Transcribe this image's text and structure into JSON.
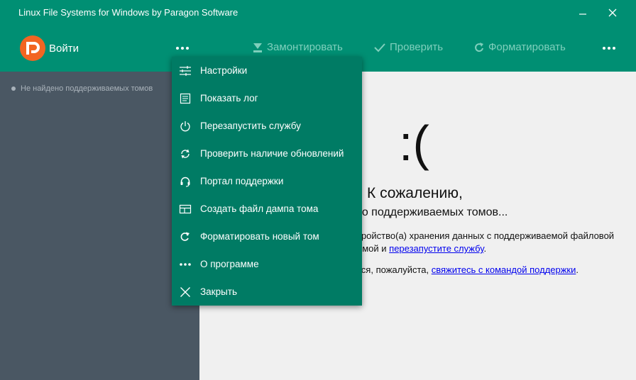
{
  "window": {
    "title": "Linux File Systems for Windows by Paragon Software"
  },
  "toolbar": {
    "login_label": "Войти",
    "mount_label": "Замонтировать",
    "check_label": "Проверить",
    "format_label": "Форматировать"
  },
  "sidebar": {
    "empty_text": "Не найдено поддерживаемых томов"
  },
  "main": {
    "sad_face": ":(",
    "heading": "К сожалению,",
    "subheading": "но поддерживаемых томов...",
    "para1_line1": "тройство(а) хранения данных с поддерживаемой файловой",
    "para1_line2_start": "емой и ",
    "para1_link": "перезапустите службу",
    "para1_line2_end": ".",
    "para2_start": "тся, пожалуйста, ",
    "para2_link": "свяжитесь с командой поддержки",
    "para2_end": "."
  },
  "menu": {
    "items": [
      {
        "label": "Настройки",
        "icon": "sliders-icon"
      },
      {
        "label": "Показать лог",
        "icon": "log-icon"
      },
      {
        "label": "Перезапустить службу",
        "icon": "power-icon"
      },
      {
        "label": "Проверить наличие обновлений",
        "icon": "refresh-icon"
      },
      {
        "label": "Портал поддержки",
        "icon": "headset-icon"
      },
      {
        "label": "Создать файл дампа тома",
        "icon": "dump-icon"
      },
      {
        "label": "Форматировать новый том",
        "icon": "format-icon"
      },
      {
        "label": "О программе",
        "icon": "dots-icon"
      },
      {
        "label": "Закрыть",
        "icon": "close-icon"
      }
    ]
  },
  "colors": {
    "accent": "#008f73",
    "menu_bg": "#007b64",
    "sidebar_bg": "#4a5763",
    "logo": "#f26522"
  }
}
